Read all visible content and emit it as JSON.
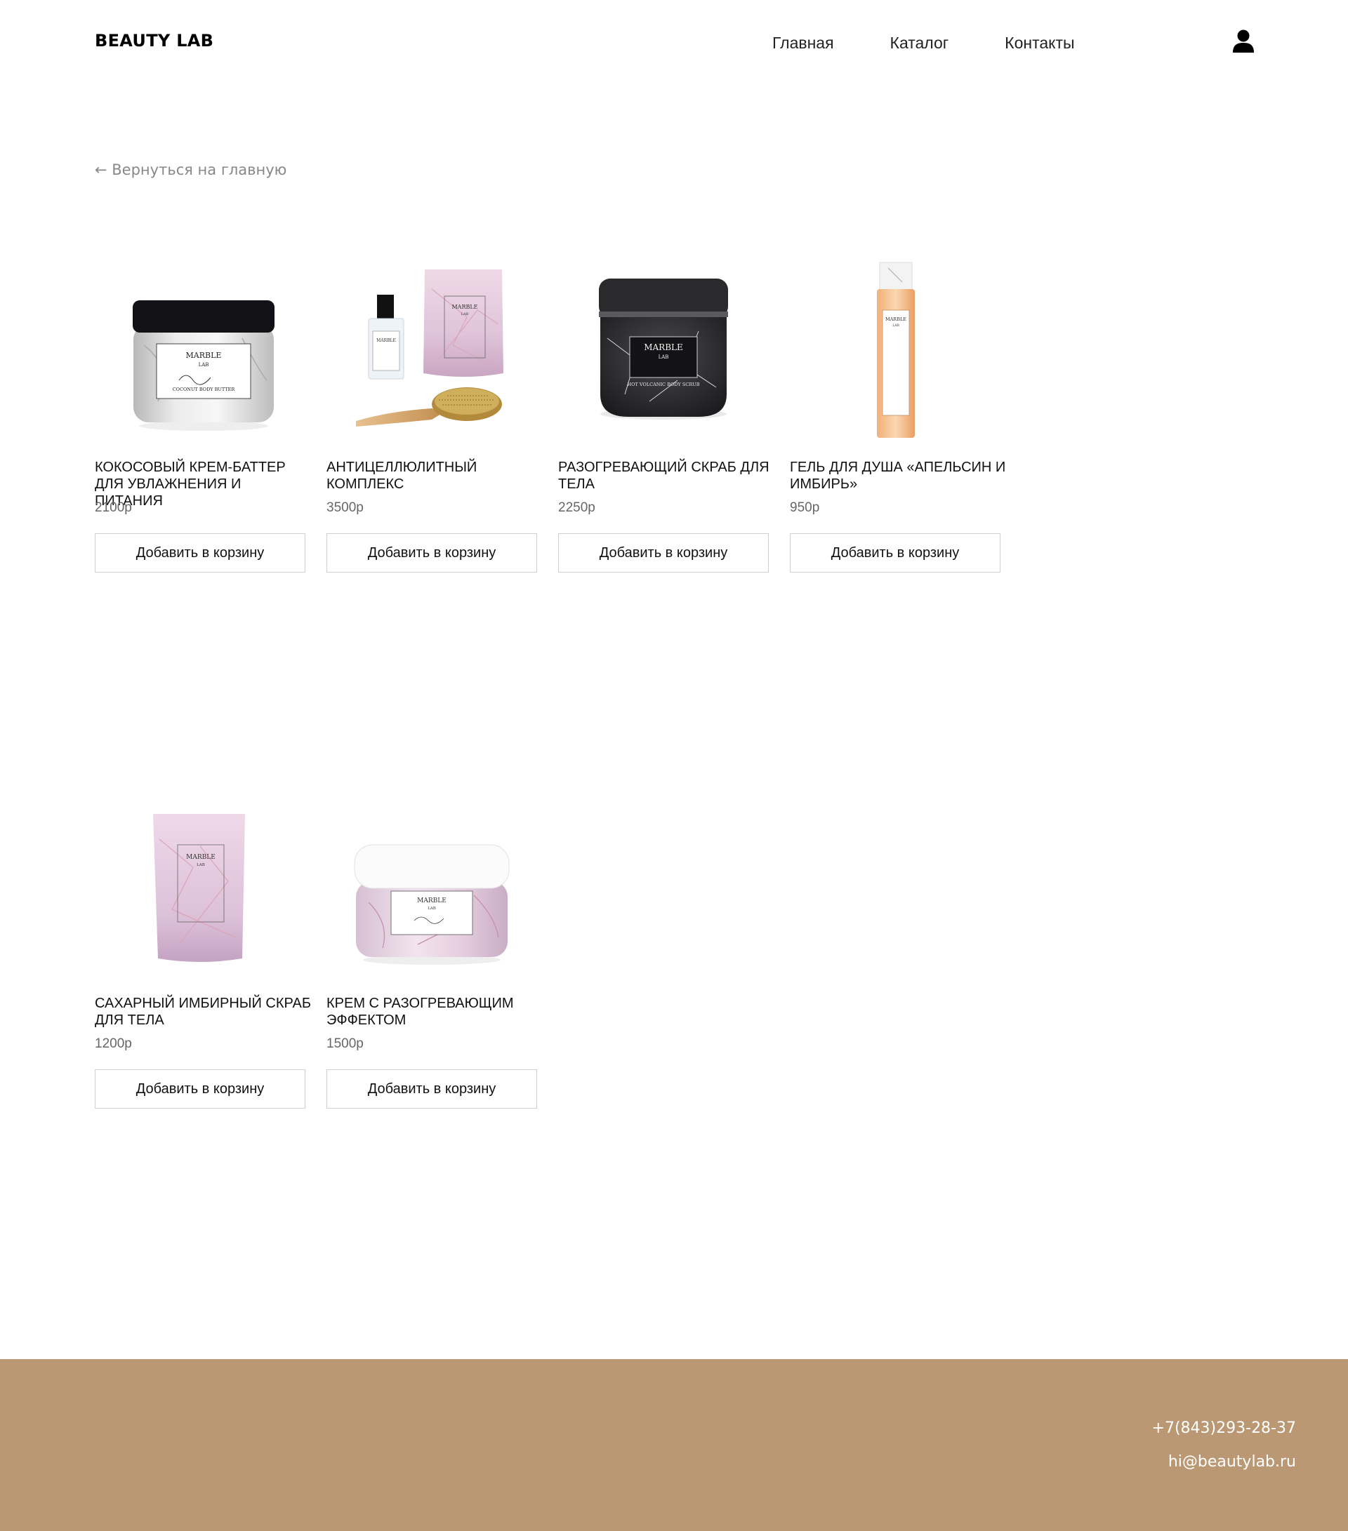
{
  "header": {
    "logo": "BEAUTY LAB",
    "nav": [
      "Главная",
      "Каталог",
      "Контакты"
    ],
    "user_icon": "user-icon"
  },
  "back_link": "← Вернуться на главную",
  "products": [
    {
      "name": "КОКОСОВЫЙ КРЕМ-БАТТЕР ДЛЯ УВЛАЖНЕНИЯ И ПИТАНИЯ",
      "price": "2100р",
      "button": "Добавить в корзину",
      "brand": "MARBLE",
      "brand_sub": "LAB",
      "label_text": "COCONUT BODY BUTTER"
    },
    {
      "name": "АНТИЦЕЛЛЮЛИТНЫЙ КОМПЛЕКС",
      "price": "3500р",
      "button": "Добавить в корзину",
      "brand": "MARBLE",
      "brand_sub": "LAB",
      "label_text": ""
    },
    {
      "name": "РАЗОГРЕВАЮЩИЙ СКРАБ ДЛЯ ТЕЛА",
      "price": "2250р",
      "button": "Добавить в корзину",
      "brand": "MARBLE",
      "brand_sub": "LAB",
      "label_text": "HOT VOLCANIC BODY SCRUB"
    },
    {
      "name": "ГЕЛЬ ДЛЯ ДУША «АПЕЛЬСИН И ИМБИРЬ»",
      "price": "950р",
      "button": "Добавить в корзину",
      "brand": "MARBLE",
      "brand_sub": "LAB",
      "label_text": ""
    },
    {
      "name": "САХАРНЫЙ ИМБИРНЫЙ СКРАБ ДЛЯ ТЕЛА",
      "price": "1200р",
      "button": "Добавить в корзину",
      "brand": "MARBLE",
      "brand_sub": "LAB",
      "label_text": ""
    },
    {
      "name": "КРЕМ С РАЗОГРЕВАЮЩИМ ЭФФЕКТОМ",
      "price": "1500р",
      "button": "Добавить в корзину",
      "brand": "MARBLE",
      "brand_sub": "LAB",
      "label_text": ""
    }
  ],
  "footer": {
    "phone": "+7(843)293-28-37",
    "email": "hi@beautylab.ru",
    "background_color": "#bb9874"
  }
}
